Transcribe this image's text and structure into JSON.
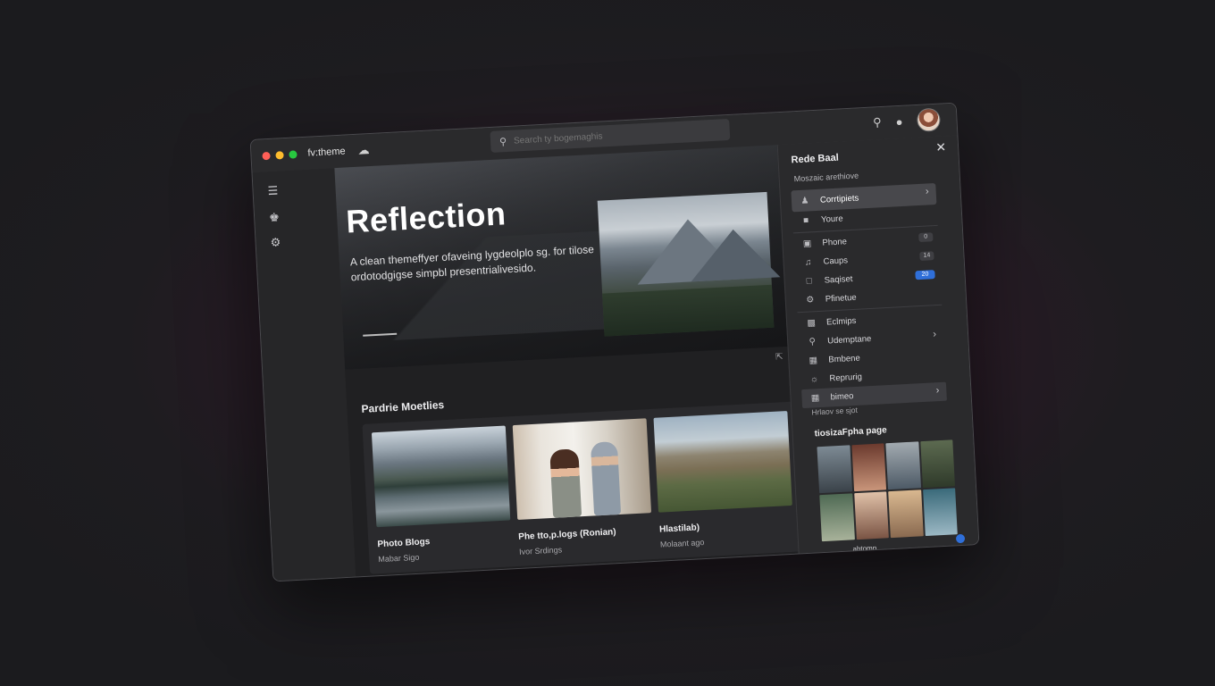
{
  "window": {
    "app_name": "fv:theme",
    "search_placeholder": "Search ty bogemaghis"
  },
  "hero": {
    "title": "Reflection",
    "description": "A clean themeffyer ofaveing lygdeolplo sg. for tilose ordotodgigse simpbl presentrialivesido."
  },
  "main": {
    "section_title": "Pardrie Moetlies",
    "cards": [
      {
        "title": "Photo Blogs",
        "subtitle": "Mabar Sigo"
      },
      {
        "title": "Phe tto,p.logs (Ronian)",
        "subtitle": "Ivor Srdings"
      },
      {
        "title": "Hlastilab)",
        "subtitle": "Molaant ago"
      }
    ]
  },
  "panel": {
    "title": "Rede Baal",
    "subtitle": "Moszaic arethiove",
    "items": [
      {
        "icon": "users-icon",
        "label": "Corrtipiets",
        "active": true
      },
      {
        "icon": "folder-icon",
        "label": "Youre"
      },
      {
        "icon": "image-icon",
        "label": "Phone",
        "badge": "0"
      },
      {
        "icon": "music-icon",
        "label": "Caups",
        "badge": "14"
      },
      {
        "icon": "chat-icon",
        "label": "Saqiset",
        "badge": "20",
        "badge_color": "#2f6fd9"
      },
      {
        "icon": "gear-icon",
        "label": "Pfinetue"
      },
      {
        "icon": "monitor-icon",
        "label": "Eclmips"
      },
      {
        "icon": "pin-icon",
        "label": "Udemptane"
      },
      {
        "icon": "grid-icon",
        "label": "Bmbene"
      },
      {
        "icon": "compass-icon",
        "label": "Reprurig"
      },
      {
        "icon": "gallery-icon",
        "label": "bimeo",
        "highlight": true
      }
    ],
    "recent_label": "Hrlaov se sjot",
    "gallery_title": "tiosizaFpha page",
    "footer_label": "ahtomp"
  },
  "colors": {
    "accent": "#2f6fd9",
    "window_bg": "#232324",
    "panel_bg": "#2a2a2c"
  }
}
